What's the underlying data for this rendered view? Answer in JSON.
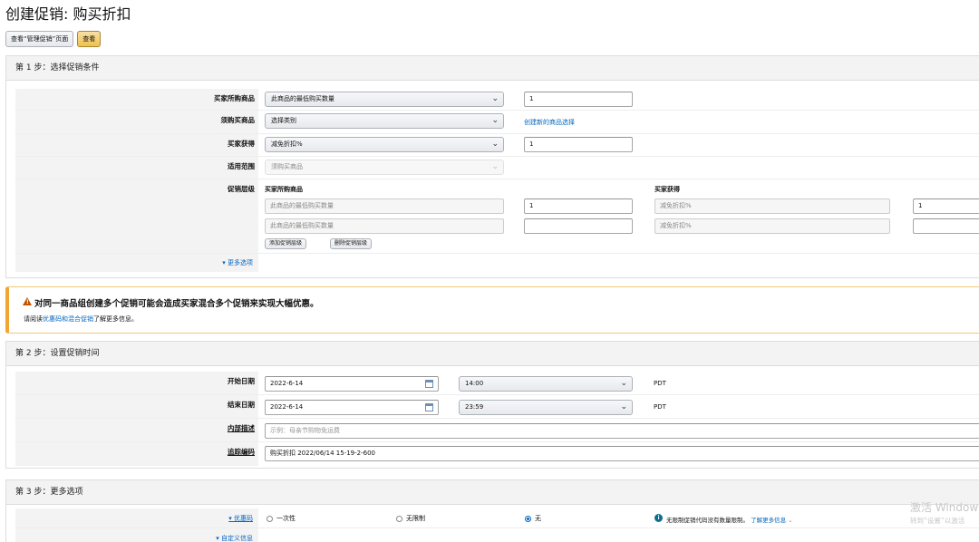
{
  "page": {
    "title": "创建促销: 购买折扣"
  },
  "top_buttons": {
    "view_manage": "查看“管理促销”页面",
    "view": "查看"
  },
  "step1": {
    "header": "第 1 步：选择促销条件",
    "buyer_purchases": {
      "label": "买家所购商品",
      "select": "此商品的最低购买数量",
      "value": "1"
    },
    "required_items": {
      "label": "须购买商品",
      "select": "选择类别",
      "link": "创建新的商品选择"
    },
    "buyer_gets": {
      "label": "买家获得",
      "select": "减免折扣%",
      "value": "1"
    },
    "applies_to": {
      "label": "适用范围",
      "select": "须购买商品"
    },
    "tiers": {
      "label": "促销层级",
      "col_buyer_purchases": "买家所购商品",
      "col_buyer_gets": "买家获得",
      "rows": [
        {
          "purchase_select": "此商品的最低购买数量",
          "purchase_value": "1",
          "gets_select": "减免折扣%",
          "gets_value": "1"
        },
        {
          "purchase_select": "此商品的最低购买数量",
          "purchase_value": "",
          "gets_select": "减免折扣%",
          "gets_value": ""
        }
      ],
      "add_button": "添加促销层级",
      "remove_button": "删除促销层级"
    },
    "more_options": "更多选项"
  },
  "alert": {
    "title": "对同一商品组创建多个促销可能会造成买家混合多个促销来实现大幅优惠。",
    "prefix": "请阅读",
    "link": "优惠码和混合促销",
    "suffix": "了解更多信息。"
  },
  "step2": {
    "header": "第 2 步：设置促销时间",
    "start": {
      "label": "开始日期",
      "date": "2022-6-14",
      "time": "14:00",
      "tz": "PDT"
    },
    "end": {
      "label": "结束日期",
      "date": "2022-6-14",
      "time": "23:59",
      "tz": "PDT"
    },
    "internal_desc": {
      "label": "内部描述",
      "placeholder": "示例：母亲节购物免运费"
    },
    "tracking_code": {
      "label": "追踪编码",
      "value": "购买折扣 2022/06/14 15-19-2-600"
    }
  },
  "step3": {
    "header": "第 3 步：更多选项",
    "coupon": {
      "label": "优惠码",
      "options": [
        "一次性",
        "无限制",
        "无"
      ],
      "selected": "无",
      "note": "无限制促销代码没有数量限制。",
      "note_link": "了解更多信息"
    },
    "custom_info": "自定义信息"
  },
  "watermark": {
    "line1": "激活 Window",
    "line2": "转到“设置”以激活"
  },
  "colors": {
    "accent_yellow": "#f0c14b",
    "link": "#0066c0",
    "alert_border": "#f0a630",
    "panel_bg": "#f3f3f3"
  }
}
